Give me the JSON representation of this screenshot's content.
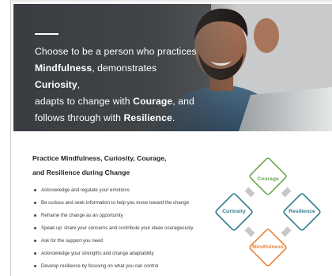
{
  "hero": {
    "line1": "Choose to be a person who practices",
    "mindfulness": "Mindfulness",
    "line2_tail": ", demonstrates ",
    "curiosity": "Curiosity",
    "line2_end": ",",
    "line3_head": "adapts to change with ",
    "courage": "Courage",
    "line3_tail": ", and",
    "line4_head": "follows through with ",
    "resilience": "Resilience",
    "line4_tail": "."
  },
  "section": {
    "title_line1": "Practice Mindfulness, Curiosity, Courage,",
    "title_line2": "and Resilience during Change",
    "bullets": [
      "Acknowledge and regulate your emotions",
      "Be curious and seek information to help you move toward the change",
      "Reframe the change as an opportunity",
      "Speak up: share your concerns and contribute your ideas courageously",
      "Ask for the support you need",
      "Acknowledge your strengths and change adaptability",
      "Develop resilience by focusing on what you can control"
    ]
  },
  "diagram": {
    "top": {
      "label": "Courage",
      "color": "#6aa84f"
    },
    "left": {
      "label": "Curiosity",
      "color": "#2e7d8c"
    },
    "right": {
      "label": "Resilience",
      "color": "#2e7d8c"
    },
    "bottom": {
      "label": "Mindfulness",
      "color": "#e8833a"
    },
    "connector_color": "#c8c8c8"
  }
}
